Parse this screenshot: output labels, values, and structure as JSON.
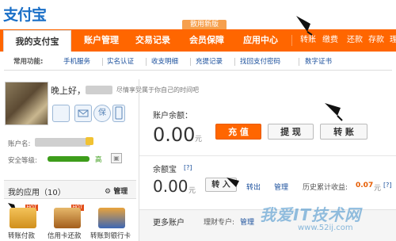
{
  "header": {
    "logo": "支付宝",
    "beta_badge": "散用新版",
    "nav": [
      "我的支付宝",
      "账户管理",
      "交易记录",
      "会员保障",
      "应用中心"
    ],
    "nav_right": [
      "转账",
      "缴费",
      "还款",
      "存款",
      "理"
    ]
  },
  "subnav": {
    "label": "常用功能:",
    "links": [
      "手机服务",
      "实名认证",
      "收支明细",
      "充提记录",
      "找回支付密码",
      "数字证书"
    ]
  },
  "profile": {
    "greeting": "晚上好，",
    "tip": "尽情享受属于你自己的时间吧",
    "account_label": "账户名:",
    "security_label": "安全等级:",
    "security_level": "高",
    "security_percent": 0.95,
    "icon_labels": [
      "",
      "保",
      ""
    ]
  },
  "apps": {
    "title": "我的应用（10）",
    "manage": "管理",
    "items": [
      "转账付款",
      "信用卡还款",
      "转账到银行卡"
    ],
    "hot_badge": "HOT"
  },
  "balance": {
    "label": "账户余额：",
    "amount": "0.00",
    "unit": "元",
    "buttons": [
      "充 值",
      "提 现",
      "转 账"
    ]
  },
  "yuebao": {
    "label": "余额宝",
    "help": "[?]",
    "amount": "0.00",
    "unit": "元",
    "transfer_in": "转 入",
    "transfer_out": "转出",
    "manage": "管理",
    "history_label": "历史累计收益:",
    "history_value": "0.07",
    "history_unit": "元",
    "help2": "[?]"
  },
  "more": {
    "label": "更多账户",
    "fund_label": "理财专户:",
    "fund_link": "管理"
  },
  "watermark": {
    "text": "我爱IT技术网",
    "url": "www.52ij.com"
  }
}
